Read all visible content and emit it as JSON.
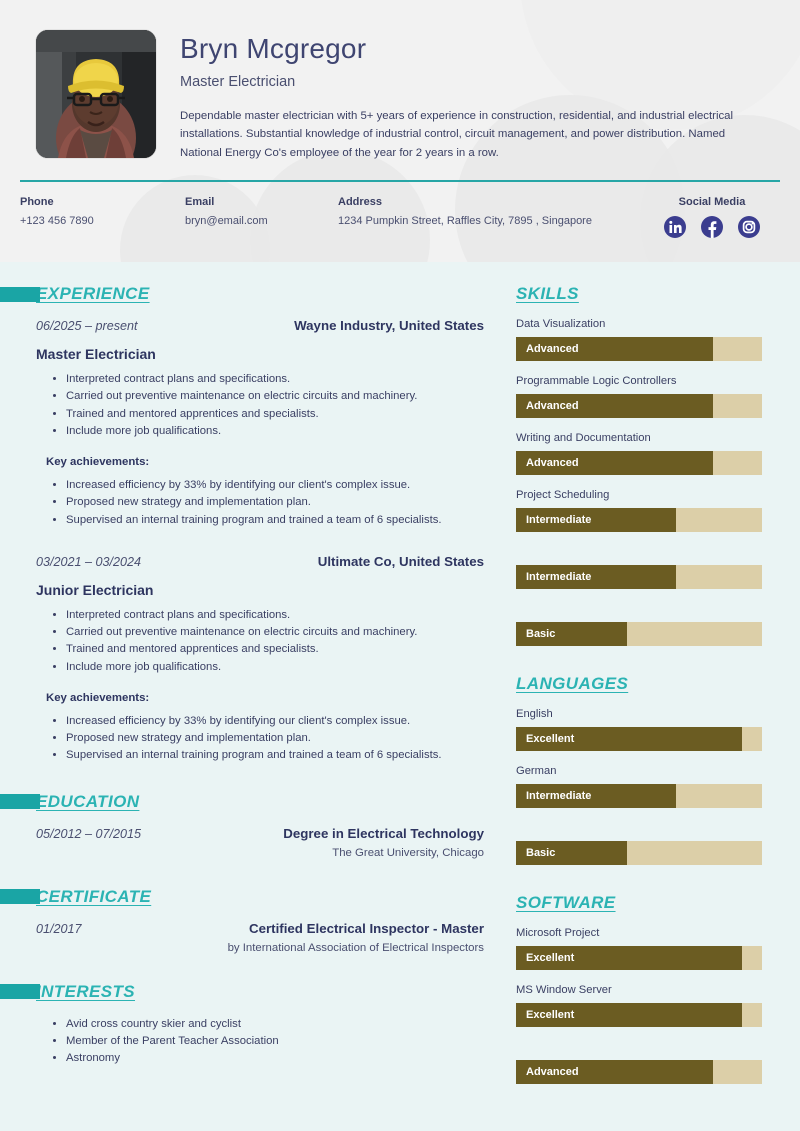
{
  "theme": {
    "accent_teal": "#2bb3b3",
    "accent_bar": "#1aa5a5",
    "header_bg": "#f2f2f2",
    "body_bg": "#eaf4f4",
    "bar_fill": "#6b5c22",
    "bar_track": "#dccfa8",
    "heading_navy": "#2e3560",
    "social_navy": "#3b3d8f"
  },
  "header": {
    "name": "Bryn Mcgregor",
    "role": "Master Electrician",
    "summary": "Dependable master electrician with 5+ years of experience in construction, residential, and industrial electrical installations. Substantial knowledge of industrial control, circuit management, and power distribution. Named National Energy Co's employee of the year for 2 years in a row.",
    "photo_alt": "profile-photo-construction-worker-hard-hat"
  },
  "contact": {
    "phone_label": "Phone",
    "phone_value": "+123 456 7890",
    "email_label": "Email",
    "email_value": "bryn@email.com",
    "address_label": "Address",
    "address_value": "1234 Pumpkin Street, Raffles City, 7895 , Singapore",
    "social_label": "Social Media",
    "social": [
      {
        "name": "linkedin",
        "icon": "linkedin-icon"
      },
      {
        "name": "facebook",
        "icon": "facebook-icon"
      },
      {
        "name": "instagram",
        "icon": "instagram-icon"
      }
    ]
  },
  "sections": {
    "experience_title": "EXPERIENCE",
    "education_title": "EDUCATION",
    "certificate_title": "CERTIFICATE",
    "interests_title": "INTERESTS",
    "skills_title": "SKILLS",
    "languages_title": "LANGUAGES",
    "software_title": "SOFTWARE"
  },
  "experience": [
    {
      "date": "06/2025 – present",
      "org": "Wayne Industry, United States",
      "title": "Master Electrician",
      "duties": [
        "Interpreted contract plans and specifications.",
        "Carried out preventive maintenance on electric circuits and machinery.",
        "Trained and mentored apprentices and specialists.",
        "Include more job qualifications."
      ],
      "achievements_label": "Key achievements:",
      "achievements": [
        "Increased efficiency by 33% by identifying our client's complex issue.",
        "Proposed new strategy and implementation plan.",
        "Supervised an internal training program and trained a team of 6 specialists."
      ]
    },
    {
      "date": "03/2021 – 03/2024",
      "org": "Ultimate Co, United States",
      "title": "Junior Electrician",
      "duties": [
        "Interpreted contract plans and specifications.",
        "Carried out preventive maintenance on electric circuits and machinery.",
        "Trained and mentored apprentices and specialists.",
        "Include more job qualifications."
      ],
      "achievements_label": "Key achievements:",
      "achievements": [
        "Increased efficiency by 33% by identifying our client's complex issue.",
        "Proposed new strategy and implementation plan.",
        "Supervised an internal training program and trained a team of 6 specialists."
      ]
    }
  ],
  "education": [
    {
      "date": "05/2012 – 07/2015",
      "title": "Degree in Electrical Technology",
      "sub": "The Great University, Chicago"
    }
  ],
  "certificate": [
    {
      "date": "01/2017",
      "title": "Certified Electrical Inspector - Master",
      "sub": "by International Association of Electrical Inspectors"
    }
  ],
  "interests": [
    "Avid cross country skier and cyclist",
    "Member of the Parent Teacher Association",
    "Astronomy"
  ],
  "chart_data": {
    "type": "bar",
    "orientation": "horizontal",
    "title": "Proficiency rating bars",
    "scale_labels": [
      "Basic",
      "Intermediate",
      "Advanced",
      "Excellent"
    ],
    "groups": [
      {
        "name": "SKILLS",
        "categories": [
          "Data Visualization",
          "Programmable Logic Controllers",
          "Writing and Documentation",
          "Project Scheduling",
          "",
          ""
        ],
        "values": [
          80,
          80,
          80,
          65,
          65,
          45
        ],
        "value_labels": [
          "Advanced",
          "Advanced",
          "Advanced",
          "Intermediate",
          "Intermediate",
          "Basic"
        ]
      },
      {
        "name": "LANGUAGES",
        "categories": [
          "English",
          "German",
          ""
        ],
        "values": [
          92,
          65,
          45
        ],
        "value_labels": [
          "Excellent",
          "Intermediate",
          "Basic"
        ]
      },
      {
        "name": "SOFTWARE",
        "categories": [
          "Microsoft Project",
          "MS Window Server",
          ""
        ],
        "values": [
          92,
          92,
          80
        ],
        "value_labels": [
          "Excellent",
          "Excellent",
          "Advanced"
        ]
      }
    ],
    "ylim": [
      0,
      100
    ],
    "grid": false,
    "legend": "none"
  }
}
